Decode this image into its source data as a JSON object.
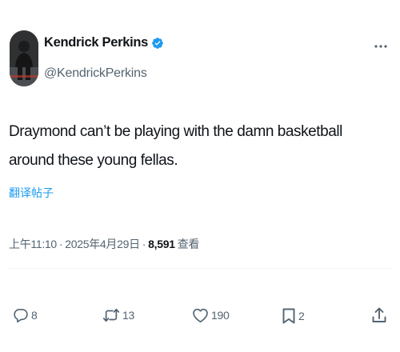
{
  "author": {
    "display_name": "Kendrick Perkins",
    "handle": "@KendrickPerkins",
    "verified": true
  },
  "tweet": {
    "text": "Draymond can’t be playing with the damn basketball around these young fellas.",
    "translate_label": "翻译帖子",
    "time": "上午11:10",
    "date": "2025年4月29日",
    "views_count": "8,591",
    "views_label": "查看"
  },
  "actions": {
    "replies": "8",
    "reposts": "13",
    "likes": "190",
    "bookmarks": "2"
  },
  "colors": {
    "text": "#0f1419",
    "secondary": "#536471",
    "accent": "#1d9bf0"
  },
  "icons": [
    "verified-badge-icon",
    "more-icon",
    "reply-icon",
    "repost-icon",
    "like-icon",
    "bookmark-icon",
    "share-icon"
  ]
}
